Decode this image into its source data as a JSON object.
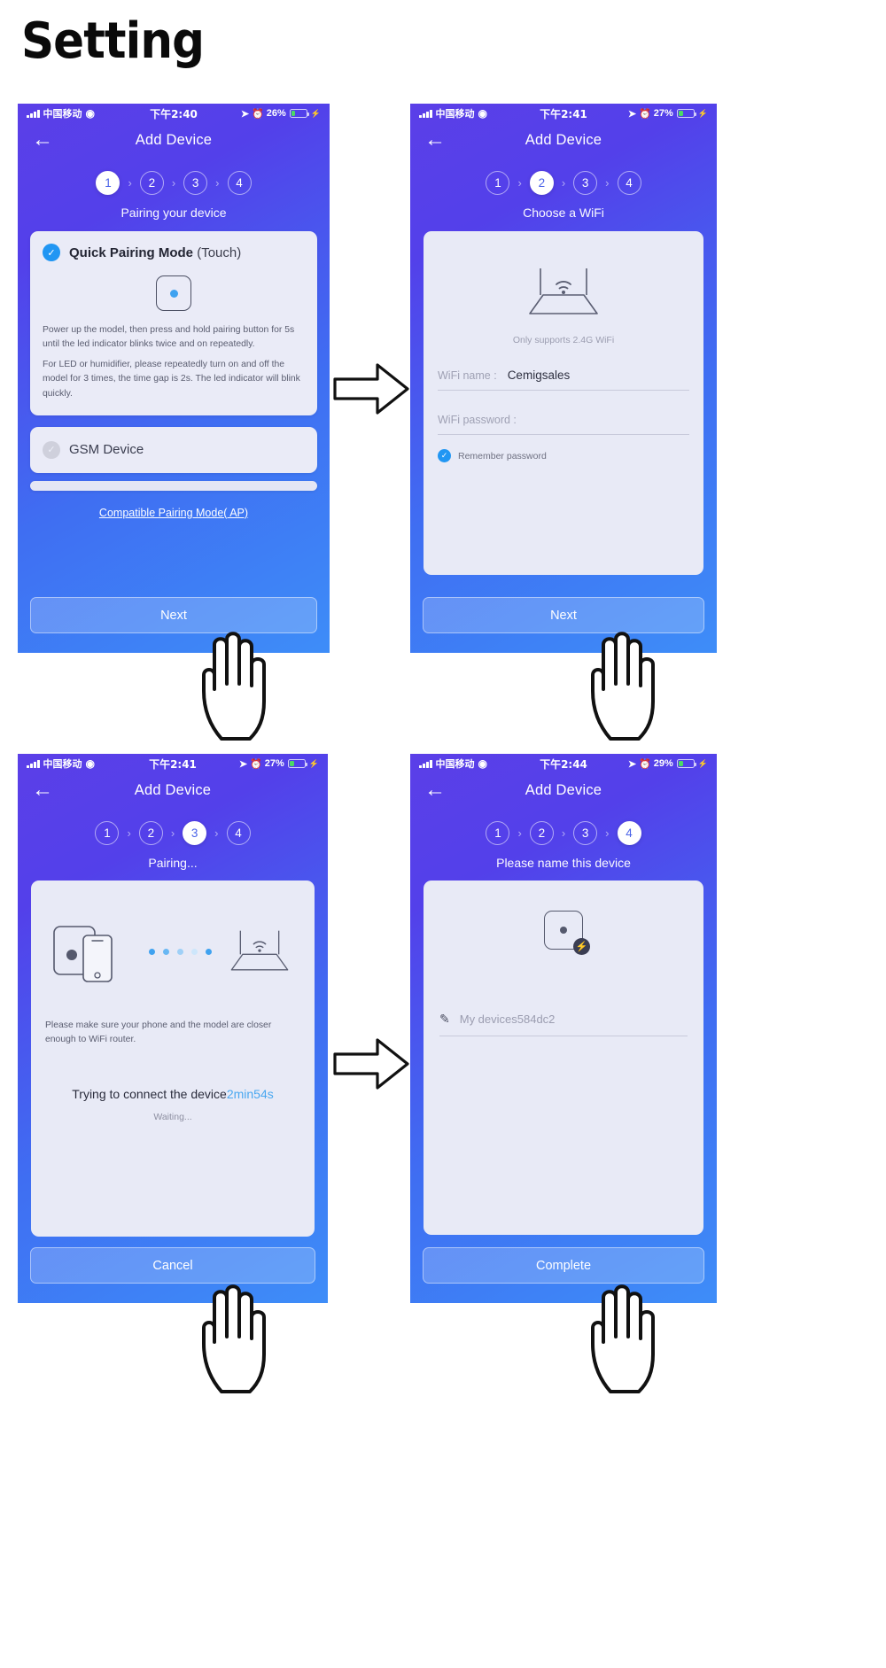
{
  "page": {
    "title": "Setting"
  },
  "screens": [
    {
      "id": "screen-1",
      "status": {
        "carrier": "中国移动",
        "time": "下午2:40",
        "battery_pct": "26%"
      },
      "nav": {
        "back_icon": "arrow-left-icon",
        "title": "Add Device"
      },
      "stepper": {
        "steps": [
          "1",
          "2",
          "3",
          "4"
        ],
        "active": 1,
        "caption": "Pairing your device"
      },
      "card": {
        "mode_title_bold": "Quick Pairing Mode",
        "mode_title_light": " (Touch)",
        "device_icon": "device-square-icon",
        "paragraph_1": "Power up the model, then press and hold pairing button for 5s until the led indicator blinks twice and on repeatedly.",
        "paragraph_2": "For LED or humidifier, please repeatedly turn on and off the model for 3 times, the time gap is 2s. The led indicator will blink quickly."
      },
      "gsm_option": {
        "label": "GSM Device",
        "selected": false
      },
      "ap_link": "Compatible Pairing Mode( AP)",
      "cta": "Next"
    },
    {
      "id": "screen-2",
      "status": {
        "carrier": "中国移动",
        "time": "下午2:41",
        "battery_pct": "27%"
      },
      "nav": {
        "back_icon": "arrow-left-icon",
        "title": "Add Device"
      },
      "stepper": {
        "steps": [
          "1",
          "2",
          "3",
          "4"
        ],
        "active": 2,
        "caption": "Choose a WiFi"
      },
      "router_caption": "Only supports 2.4G WiFi",
      "wifi_name": {
        "label": "WiFi name :",
        "value": "Cemigsales"
      },
      "wifi_password": {
        "label": "WiFi password :",
        "value": ""
      },
      "remember": {
        "label": "Remember password",
        "checked": true
      },
      "cta": "Next"
    },
    {
      "id": "screen-3",
      "status": {
        "carrier": "中国移动",
        "time": "下午2:41",
        "battery_pct": "27%"
      },
      "nav": {
        "back_icon": "arrow-left-icon",
        "title": "Add Device"
      },
      "stepper": {
        "steps": [
          "1",
          "2",
          "3",
          "4"
        ],
        "active": 3,
        "caption": "Pairing..."
      },
      "note": "Please make sure your phone and the model are closer enough to WiFi router.",
      "connect_text": "Trying to connect the device",
      "connect_timer": "2min54s",
      "waiting": "Waiting...",
      "cta": "Cancel"
    },
    {
      "id": "screen-4",
      "status": {
        "carrier": "中国移动",
        "time": "下午2:44",
        "battery_pct": "29%"
      },
      "nav": {
        "back_icon": "arrow-left-icon",
        "title": "Add Device"
      },
      "stepper": {
        "steps": [
          "1",
          "2",
          "3",
          "4"
        ],
        "active": 4,
        "caption": "Please name this device"
      },
      "device_name": {
        "value": "My devices584dc2",
        "edit_icon": "pencil-icon"
      },
      "cta": "Complete"
    }
  ],
  "colors": {
    "gradient_start": "#5b3fe8",
    "gradient_end": "#3e8df8",
    "accent_blue": "#2196f3",
    "card_bg": "#eaebf7",
    "timer_blue": "#4aa8f0",
    "battery_green": "#4cd964"
  }
}
